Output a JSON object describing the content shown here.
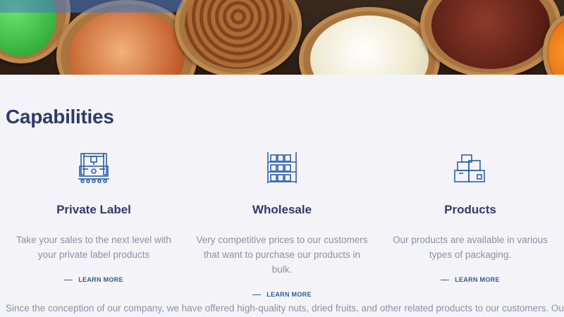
{
  "section": {
    "title": "Capabilities"
  },
  "cards": [
    {
      "title": "Private Label",
      "desc_line1": "Take your sales to the next level with",
      "desc_line2": "your private label products",
      "link": "LEARN MORE",
      "icon": "factory-machine-icon"
    },
    {
      "title": "Wholesale",
      "desc_line1": "Very competitive prices to our customers",
      "desc_line2": "that want to purchase our products in bulk.",
      "link": "LEARN MORE",
      "icon": "warehouse-shelves-icon"
    },
    {
      "title": "Products",
      "desc_line1": "Our products are available in various",
      "desc_line2": "types of packaging.",
      "link": "LEARN MORE",
      "icon": "stacked-boxes-icon"
    }
  ],
  "intro": "Since the conception of our company, we have offered high-quality nuts, dried fruits, and other related products to our customers. Our",
  "colors": {
    "heading": "#2f3a6b",
    "body_text": "#8a8fa6",
    "link": "#2f5d8f",
    "icon": "#2a5fa8"
  }
}
